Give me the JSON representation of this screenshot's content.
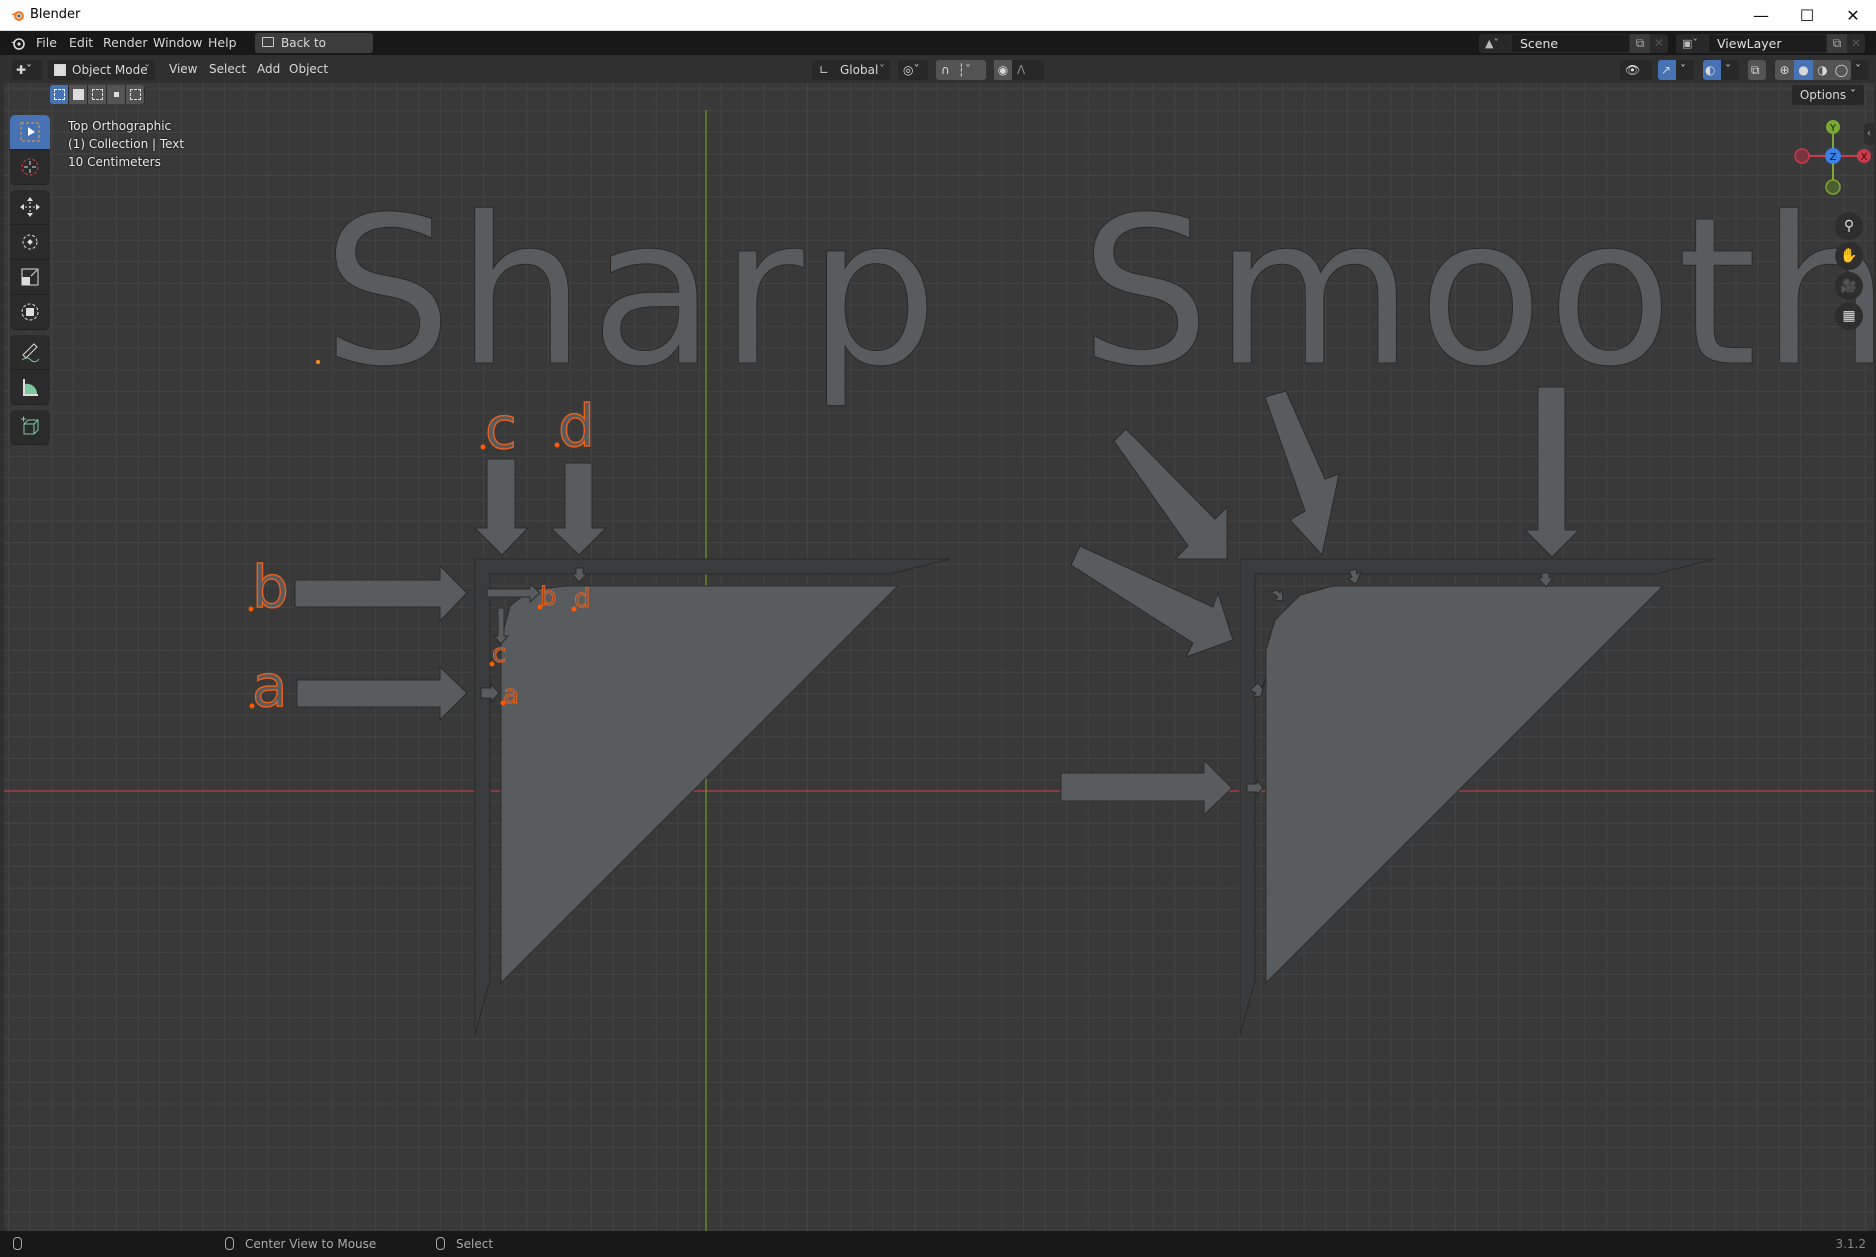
{
  "window": {
    "title": "Blender",
    "controls": [
      "minimize",
      "maximize",
      "close"
    ]
  },
  "menubar": {
    "items": [
      "File",
      "Edit",
      "Render",
      "Window",
      "Help"
    ],
    "back_button": "Back to Previous",
    "scene": {
      "value": "Scene"
    },
    "view_layer": {
      "value": "ViewLayer"
    }
  },
  "viewport_header": {
    "mode": "Object Mode",
    "menus": [
      "View",
      "Select",
      "Add",
      "Object"
    ],
    "orientation": "Global",
    "options_label": "Options",
    "shading_active": "solid"
  },
  "overlay": {
    "view_name": "Top Orthographic",
    "collection": "(1) Collection | Text",
    "scale": "10 Centimeters"
  },
  "tools": [
    "select-box",
    "cursor",
    "move",
    "rotate",
    "scale",
    "transform",
    "annotate",
    "measure",
    "add-cube"
  ],
  "gizmo": {
    "x": "X",
    "y": "Y",
    "z": "Z"
  },
  "scene_text": {
    "sharp_title": "Sharp",
    "smooth_title": "Smooth",
    "labels_large": [
      "a",
      "b",
      "c",
      "d"
    ],
    "labels_small": [
      "a",
      "b",
      "c",
      "d"
    ]
  },
  "statusbar": {
    "hint1": "Center View to Mouse",
    "hint2": "Select",
    "version": "3.1.2"
  },
  "colors": {
    "accent_blue": "#4772b3",
    "selection_orange": "#e8601c",
    "axis_x": "#c83c4b",
    "axis_y": "#7aa834",
    "axis_z": "#3b82e6",
    "object_fill": "#585c5e"
  }
}
